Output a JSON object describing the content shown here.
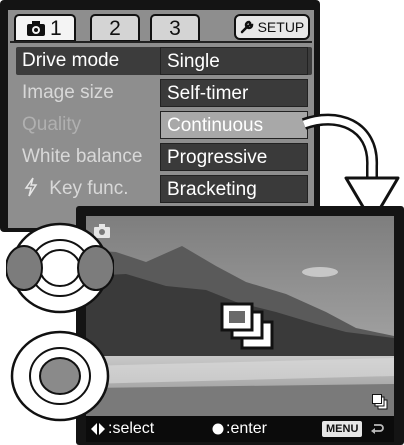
{
  "menu": {
    "tabs": [
      "1",
      "2",
      "3"
    ],
    "setup_label": "SETUP",
    "rows": [
      {
        "label": "Drive mode",
        "option": "Single"
      },
      {
        "label": "Image size",
        "option": "Self-timer"
      },
      {
        "label": "Quality",
        "option": "Continuous"
      },
      {
        "label": "White balance",
        "option": "Progressive"
      },
      {
        "label": "Key func.",
        "option": "Bracketing"
      }
    ]
  },
  "preview": {
    "select_label": ":select",
    "enter_label": ":enter",
    "menu_button": "MENU"
  },
  "icons": {
    "camera": "camera-icon",
    "setup": "wrench-icon",
    "key_func": "lightning-icon",
    "drive": "continuous-drive-icon",
    "arrow": "curved-arrow-icon",
    "return": "return-icon"
  },
  "colors": {
    "menu_bg": "#8e8e8e",
    "option_bg": "#3a3a3a",
    "option_selected_bg": "#a8a8a8",
    "screen_bg": "#141414"
  }
}
